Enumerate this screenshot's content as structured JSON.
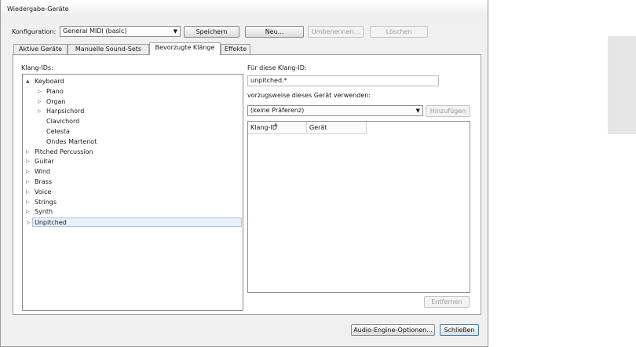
{
  "window": {
    "title": "Wiedergabe-Geräte"
  },
  "config": {
    "label": "Konfiguration:",
    "selected": "General MIDI (basic)",
    "buttons": {
      "save": "Speichern",
      "new": "Neu...",
      "rename": "Umbenennen...",
      "delete": "Löschen"
    }
  },
  "tabs": [
    {
      "label": "Aktive Geräte"
    },
    {
      "label": "Manuelle Sound-Sets"
    },
    {
      "label": "Bevorzugte Klänge"
    },
    {
      "label": "Effekte"
    }
  ],
  "active_tab": "Bevorzugte Klänge",
  "left": {
    "label": "Klang-IDs:",
    "tree": [
      {
        "label": "Keyboard",
        "level": 0,
        "expander": "expanded"
      },
      {
        "label": "Piano",
        "level": 1,
        "expander": "collapsed"
      },
      {
        "label": "Organ",
        "level": 1,
        "expander": "collapsed"
      },
      {
        "label": "Harpsichord",
        "level": 1,
        "expander": "collapsed"
      },
      {
        "label": "Clavichord",
        "level": 1,
        "expander": "none"
      },
      {
        "label": "Celesta",
        "level": 1,
        "expander": "none"
      },
      {
        "label": "Ondes Martenot",
        "level": 1,
        "expander": "none"
      },
      {
        "label": "Pitched Percussion",
        "level": 0,
        "expander": "collapsed"
      },
      {
        "label": "Guitar",
        "level": 0,
        "expander": "collapsed"
      },
      {
        "label": "Wind",
        "level": 0,
        "expander": "collapsed"
      },
      {
        "label": "Brass",
        "level": 0,
        "expander": "collapsed"
      },
      {
        "label": "Voice",
        "level": 0,
        "expander": "collapsed"
      },
      {
        "label": "Strings",
        "level": 0,
        "expander": "collapsed"
      },
      {
        "label": "Synth",
        "level": 0,
        "expander": "collapsed"
      },
      {
        "label": "Unpitched",
        "level": 0,
        "expander": "collapsed",
        "selected": true
      }
    ]
  },
  "right": {
    "for_label": "Für diese Klang-ID:",
    "sound_id_value": "unpitched.*",
    "prefer_label": "vorzugsweise dieses Gerät verwenden:",
    "device_selected": "(keine Präferenz)",
    "add_button": "Hinzufügen",
    "table_headers": [
      "Klang-ID",
      "Gerät"
    ],
    "remove_button": "Entfernen"
  },
  "footer": {
    "audio_engine": "Audio-Engine-Optionen...",
    "close": "Schließen"
  },
  "icons": {
    "expanded": "▲",
    "collapsed": "▷",
    "dropdown": "▼",
    "sort": "▲"
  }
}
